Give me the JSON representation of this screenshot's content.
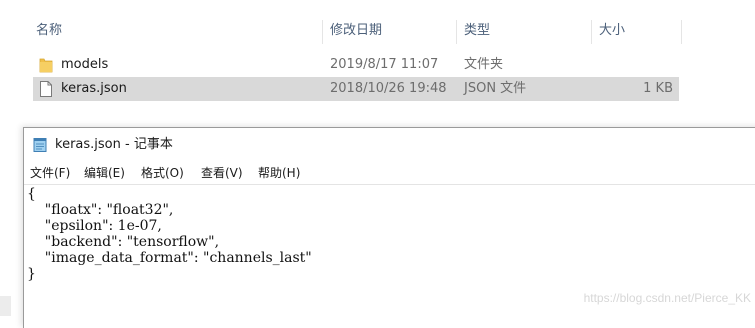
{
  "explorer": {
    "columns": {
      "name": "名称",
      "date_modified": "修改日期",
      "type": "类型",
      "size": "大小"
    },
    "files": [
      {
        "name": "models",
        "date": "2019/8/17 11:07",
        "type": "文件夹",
        "size": "",
        "icon": "folder-icon",
        "selected": false
      },
      {
        "name": "keras.json",
        "date": "2018/10/26 19:48",
        "type": "JSON 文件",
        "size": "1 KB",
        "icon": "file-icon",
        "selected": true
      }
    ]
  },
  "notepad": {
    "title": "keras.json - 记事本",
    "menu": [
      "文件(F)",
      "编辑(E)",
      "格式(O)",
      "查看(V)",
      "帮助(H)"
    ],
    "lines": [
      "{",
      "    \"floatx\": \"float32\",",
      "    \"epsilon\": 1e-07,",
      "    \"backend\": \"tensorflow\",",
      "    \"image_data_format\": \"channels_last\"",
      "}"
    ]
  },
  "watermark": "https://blog.csdn.net/Pierce_KK",
  "colors": {
    "selected_row": "#d9d9d9",
    "header_text": "#4c607a",
    "folder": "#f0c04a"
  }
}
